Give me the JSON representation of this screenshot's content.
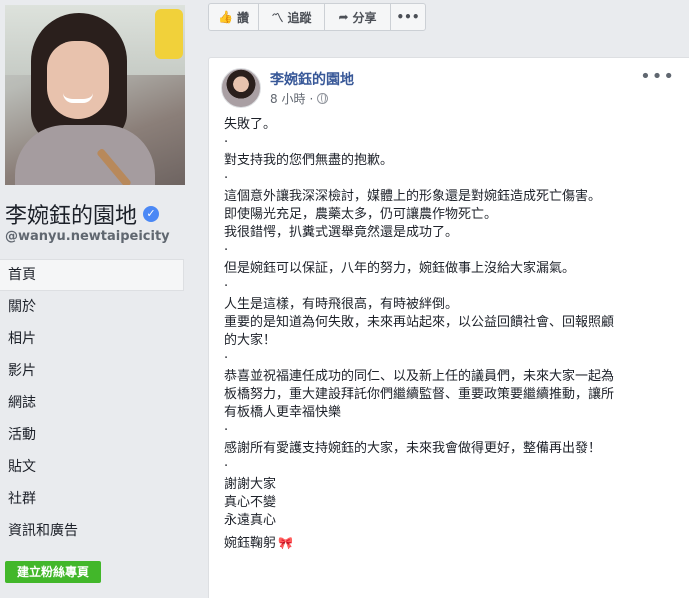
{
  "left": {
    "page_name": "李婉鈺的園地",
    "handle": "@wanyu.newtaipeicity",
    "nav": [
      "首頁",
      "關於",
      "相片",
      "影片",
      "網誌",
      "活動",
      "貼文",
      "社群",
      "資訊和廣告"
    ],
    "create_page_button": "建立粉絲專頁"
  },
  "action_bar": {
    "like_label": "讚",
    "follow_label": "追蹤",
    "share_label": "分享",
    "more_label": "•••"
  },
  "post": {
    "author": "李婉鈺的園地",
    "time": "8 小時",
    "separator": "·",
    "menu": "•••",
    "lines": [
      "失敗了。",
      ".",
      "對支持我的您們無盡的抱歉。",
      ".",
      "這個意外讓我深深檢討，媒體上的形象還是對婉鈺造成死亡傷害。",
      "即使陽光充足，農藥太多，仍可讓農作物死亡。",
      "我很錯愕，扒糞式選舉竟然還是成功了。",
      ".",
      "但是婉鈺可以保証，八年的努力，婉鈺做事上沒給大家漏氣。",
      ".",
      "人生是這樣，有時飛很高，有時被絆倒。",
      "重要的是知道為何失敗，未來再站起來，以公益回饋社會、回報照顧",
      "的大家！",
      ".",
      "恭喜並祝福連任成功的同仁、以及新上任的議員們，未來大家一起為",
      "板橋努力，重大建設拜託你們繼續監督、重要政策要繼續推動，讓所",
      "有板橋人更幸福快樂",
      ".",
      "感謝所有愛護支持婉鈺的大家，未來我會做得更好，整備再出發！",
      ".",
      "謝謝大家",
      "真心不變",
      "永遠真心",
      "",
      "婉鈺鞠躬"
    ],
    "signature_emoji": "🎀"
  },
  "colors": {
    "link": "#385898",
    "verified": "#4b88f5",
    "create_button": "#42b72a",
    "background": "#e9ebee"
  },
  "icons": [
    "verified-icon",
    "thumbs-up-icon",
    "rss-icon",
    "share-arrow-icon",
    "globe-icon",
    "ribbon-icon"
  ]
}
